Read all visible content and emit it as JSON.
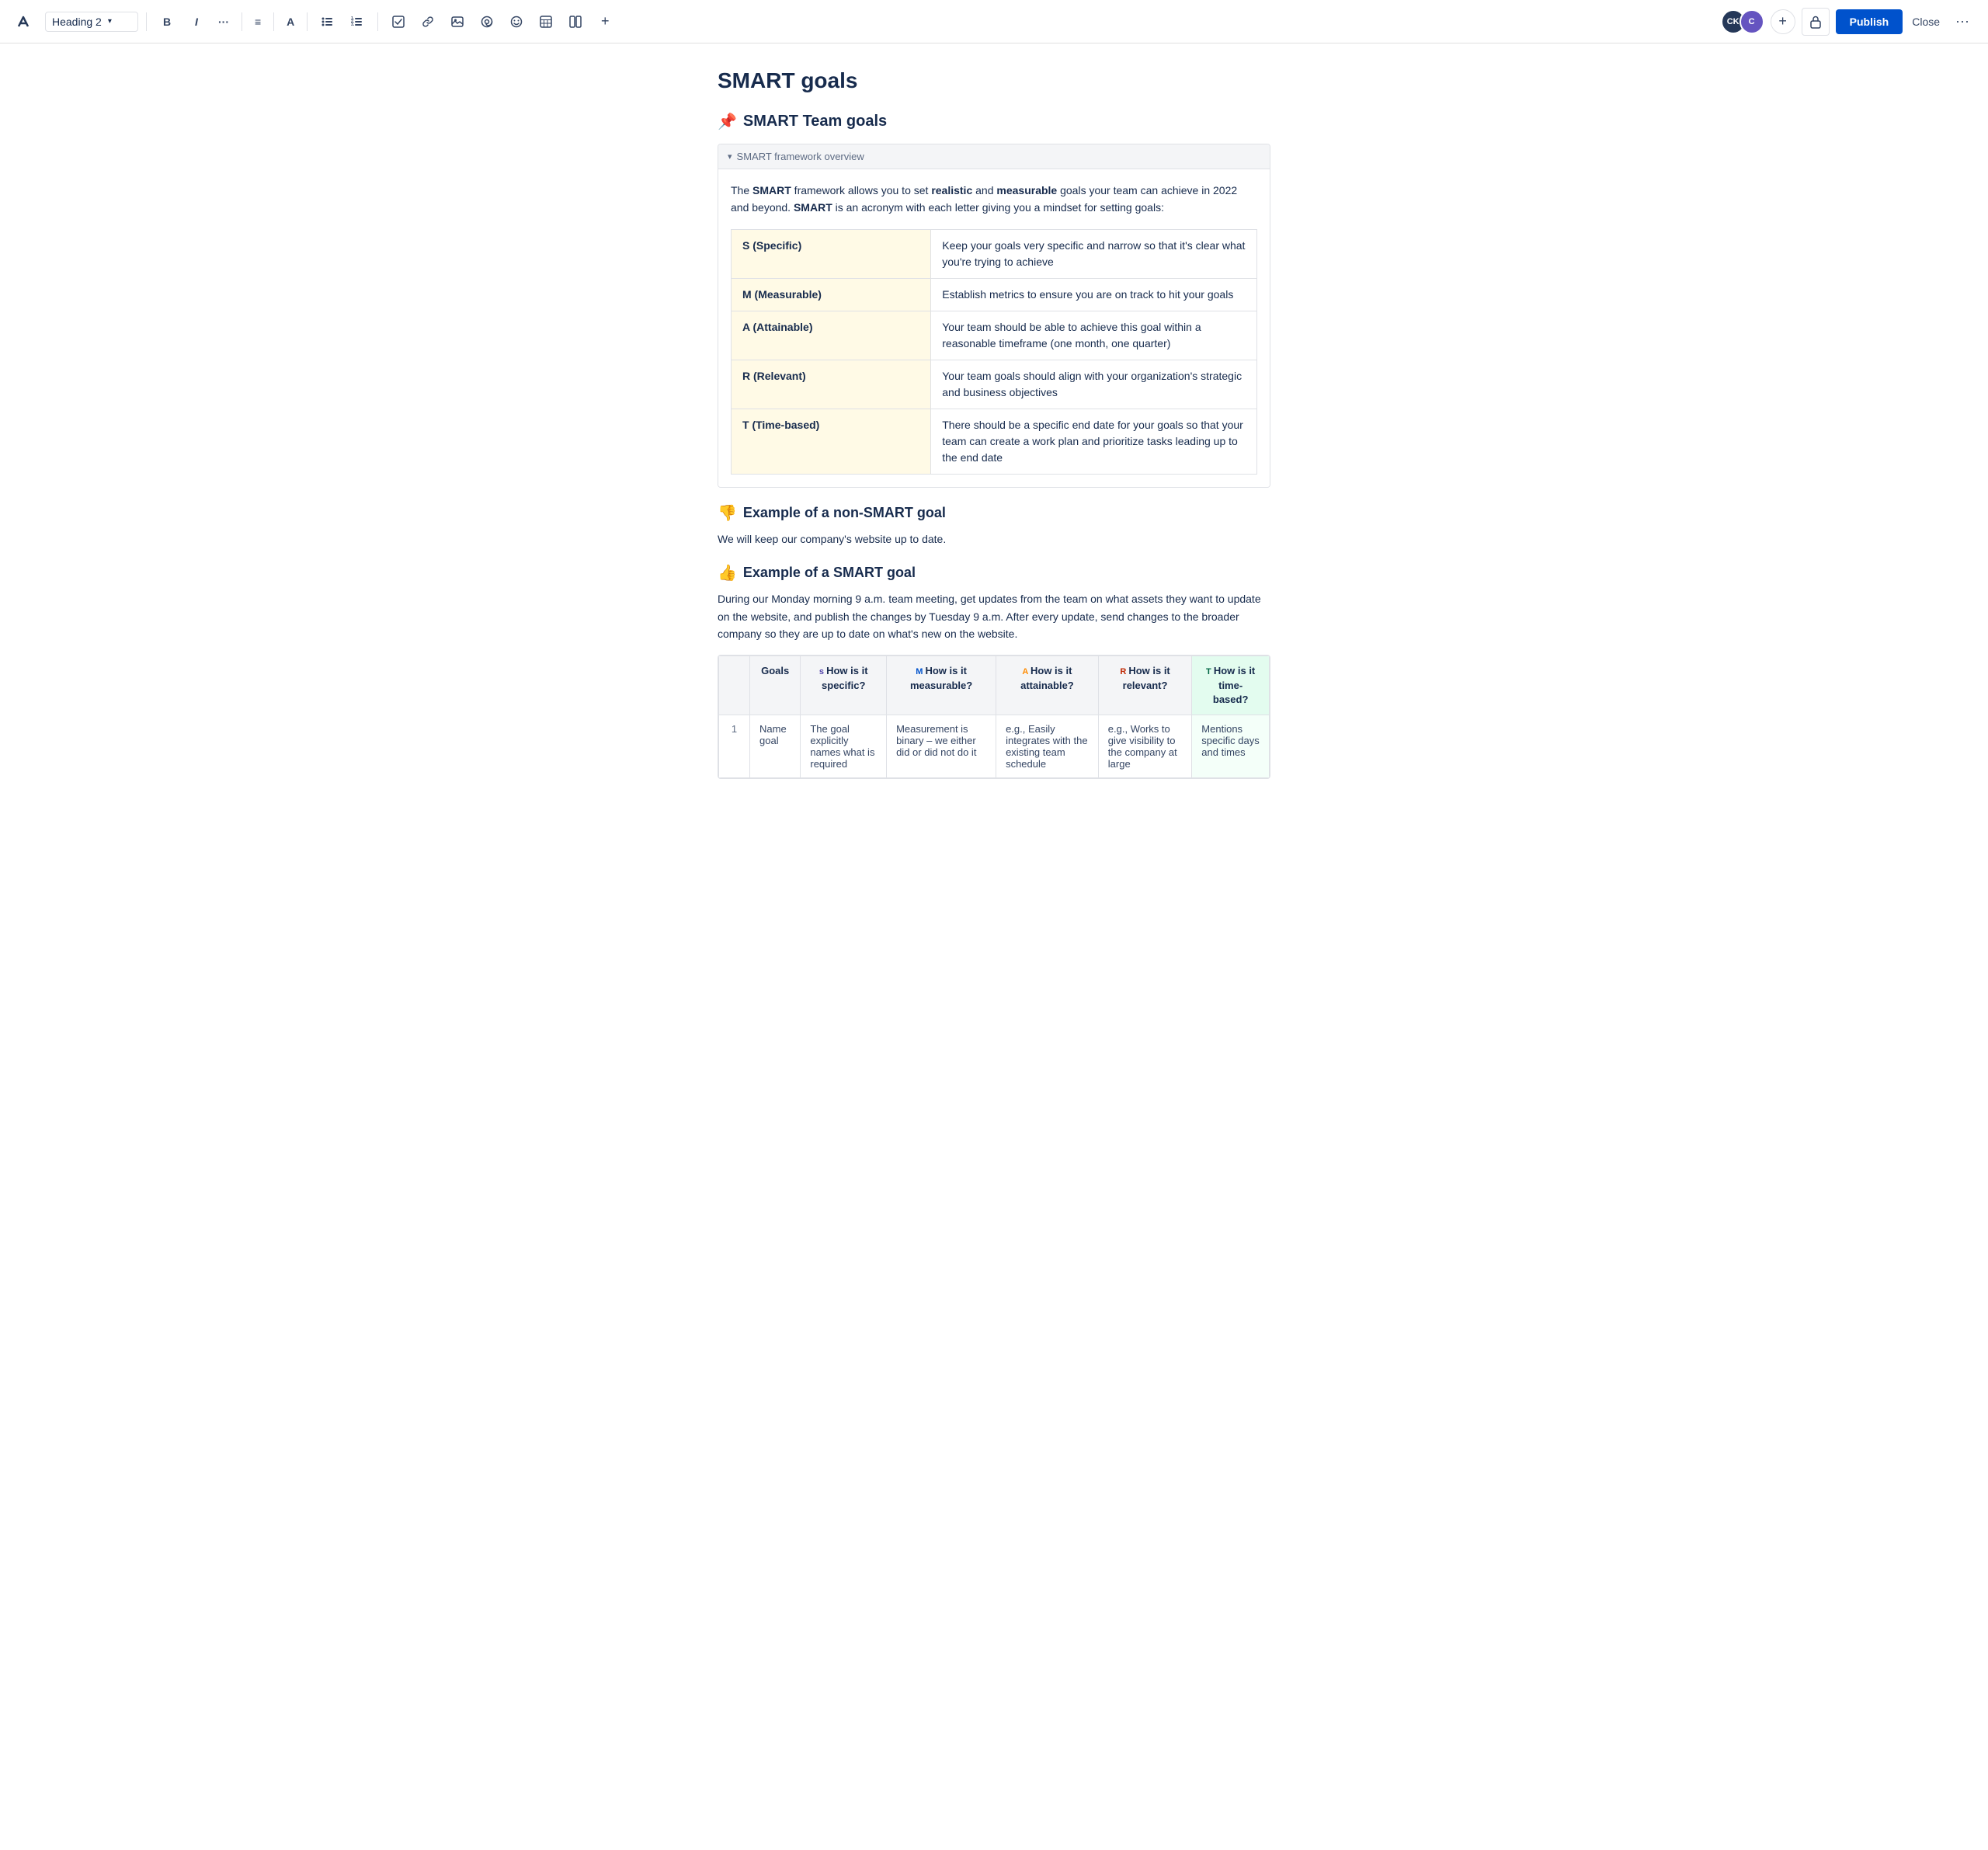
{
  "toolbar": {
    "heading_select_label": "Heading 2",
    "bold_label": "B",
    "italic_label": "I",
    "more_format_label": "···",
    "align_label": "≡",
    "color_label": "A",
    "bullet_label": "•",
    "ordered_label": "#",
    "task_label": "✓",
    "link_label": "🔗",
    "image_label": "🖼",
    "mention_label": "@",
    "emoji_label": "☺",
    "table_label": "⊞",
    "layout_label": "⊟",
    "more_insert_label": "+",
    "add_btn_label": "+",
    "publish_label": "Publish",
    "close_label": "Close",
    "more_label": "···",
    "avatar_ck": "CK",
    "avatar_c": "C"
  },
  "page": {
    "title": "SMART goals",
    "section_heading_icon": "📌",
    "section_heading": "SMART Team goals",
    "expand_panel_label": "SMART framework overview",
    "intro_text_1": "The ",
    "intro_bold_1": "SMART",
    "intro_text_2": " framework allows you to set ",
    "intro_bold_2": "realistic",
    "intro_text_3": " and ",
    "intro_bold_3": "measurable",
    "intro_text_4": " goals your team can achieve in 2022 and beyond. ",
    "intro_bold_4": "SMART",
    "intro_text_5": " is an acronym with each letter giving you a mindset for setting goals:",
    "smart_rows": [
      {
        "key": "S (Specific)",
        "value": "Keep your goals very specific and narrow so that it's clear what you're trying to achieve"
      },
      {
        "key": "M (Measurable)",
        "value": "Establish metrics to ensure you are on track to hit your goals"
      },
      {
        "key": "A (Attainable)",
        "value": "Your team should be able to achieve this goal within a reasonable timeframe (one month, one quarter)"
      },
      {
        "key": "R (Relevant)",
        "value": "Your team goals should align with your organization's strategic and business objectives"
      },
      {
        "key": "T (Time-based)",
        "value": "There should be a specific end date for your goals so that your team can create a work plan and prioritize tasks leading up to the end date"
      }
    ],
    "non_smart_heading_icon": "👎",
    "non_smart_heading": "Example of a non-SMART goal",
    "non_smart_text": "We will keep our company's website up to date.",
    "smart_heading_icon": "👍",
    "smart_heading": "Example of a SMART goal",
    "smart_text": "During our Monday morning 9 a.m. team meeting, get updates from the team on what assets they want to update on the website, and publish the changes by Tuesday 9 a.m. After every update, send changes to the broader company so they are up to date on what's new on the website.",
    "goals_table": {
      "headers": [
        {
          "id": "num",
          "label": ""
        },
        {
          "id": "goals",
          "label": "Goals"
        },
        {
          "id": "specific",
          "label_prefix": "s",
          "label_main": "How is it specific?",
          "color_class": "th-s",
          "bg": ""
        },
        {
          "id": "measurable",
          "label_prefix": "M",
          "label_main": "How is it measurable?",
          "color_class": "th-m",
          "bg": ""
        },
        {
          "id": "attainable",
          "label_prefix": "A",
          "label_main": "How is it attainable?",
          "color_class": "th-a",
          "bg": ""
        },
        {
          "id": "relevant",
          "label_prefix": "R",
          "label_main": "How is it relevant?",
          "color_class": "th-r",
          "bg": ""
        },
        {
          "id": "timebased",
          "label_prefix": "T",
          "label_main": "How is it time-based?",
          "color_class": "th-t",
          "bg": "#e3fcef"
        }
      ],
      "rows": [
        {
          "num": "1",
          "goals": "Name goal",
          "specific": "The goal explicitly names what is required",
          "measurable": "Measurement is binary – we either did or did not do it",
          "attainable": "e.g., Easily integrates with the existing team schedule",
          "relevant": "e.g., Works to give visibility to the company at large",
          "timebased": "Mentions specific days and times"
        }
      ]
    }
  }
}
